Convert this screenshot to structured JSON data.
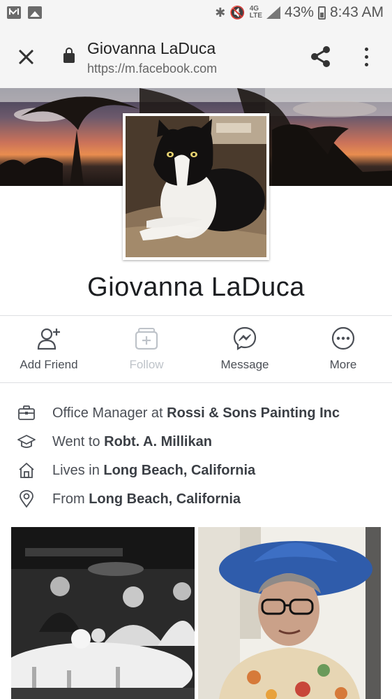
{
  "status_bar": {
    "icons_left": [
      "gmail-icon",
      "gallery-icon"
    ],
    "network": "4G LTE",
    "battery": "43%",
    "time": "8:43 AM"
  },
  "browser": {
    "title": "Giovanna LaDuca",
    "url": "https://m.facebook.com"
  },
  "profile": {
    "name": "Giovanna LaDuca"
  },
  "actions": [
    {
      "label": "Add Friend",
      "icon": "add-friend-icon",
      "enabled": true
    },
    {
      "label": "Follow",
      "icon": "follow-icon",
      "enabled": false
    },
    {
      "label": "Message",
      "icon": "messenger-icon",
      "enabled": true
    },
    {
      "label": "More",
      "icon": "more-icon",
      "enabled": true
    }
  ],
  "info": [
    {
      "icon": "briefcase-icon",
      "prefix": "Office Manager at ",
      "value": "Rossi & Sons Painting Inc"
    },
    {
      "icon": "graduation-cap-icon",
      "prefix": "Went to ",
      "value": "Robt. A. Millikan"
    },
    {
      "icon": "home-icon",
      "prefix": "Lives in ",
      "value": "Long Beach, California"
    },
    {
      "icon": "location-pin-icon",
      "prefix": "From ",
      "value": "Long Beach, California"
    }
  ],
  "colors": {
    "text": "#1c1e21",
    "secondary_text": "#4b4f56",
    "disabled_text": "#bec3c9",
    "divider": "#dddfe2"
  }
}
